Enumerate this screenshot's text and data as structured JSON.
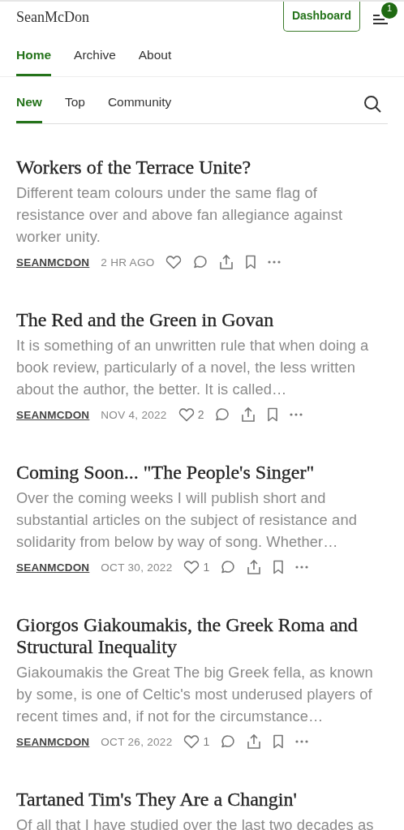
{
  "header": {
    "site_name": "SeanMcDon",
    "dashboard_button": "Dashboard",
    "notification_badge": "1"
  },
  "nav_tabs": [
    {
      "label": "Home",
      "selected": true
    },
    {
      "label": "Archive",
      "selected": false
    },
    {
      "label": "About",
      "selected": false
    }
  ],
  "feed_tabs": [
    {
      "label": "New",
      "selected": true
    },
    {
      "label": "Top",
      "selected": false
    },
    {
      "label": "Community",
      "selected": false
    }
  ],
  "posts": [
    {
      "title": "Workers of the Terrace Unite?",
      "excerpt": "Different team colours under the same flag of resistance over and above fan allegiance against worker unity.",
      "author": "SEANMCDON",
      "date": "2 HR AGO"
    },
    {
      "title": "The Red and the Green in Govan",
      "excerpt": "It is something of an unwritten rule that when doing a book review, particularly of a novel, the less written about the author, the better. It is called…",
      "author": "SEANMCDON",
      "date": "NOV 4, 2022",
      "likes": "2"
    },
    {
      "title": "Coming Soon... \"The People's Singer\"",
      "excerpt": "Over the coming weeks I will publish short and substantial articles on the subject of resistance and solidarity from below by way of song. Whether…",
      "author": "SEANMCDON",
      "date": "OCT 30, 2022",
      "likes": "1"
    },
    {
      "title": "Giorgos Giakoumakis, the Greek Roma and Structural Inequality",
      "excerpt": "Giakoumakis the Great The big Greek fella, as known by some, is one of Celtic's most underused players of recent times and, if not for the circumstance…",
      "author": "SEANMCDON",
      "date": "OCT 26, 2022",
      "likes": "1"
    },
    {
      "title": "Tartaned Tim's They Are a Changin'",
      "excerpt": "Of all that I have studied over the last two decades as"
    }
  ]
}
